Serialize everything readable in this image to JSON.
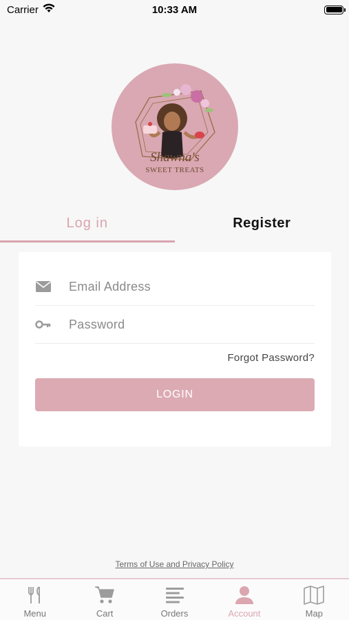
{
  "status_bar": {
    "carrier": "Carrier",
    "time": "10:33 AM"
  },
  "logo": {
    "line1": "Shawna's",
    "line2": "SWEET TREATS"
  },
  "tabs": {
    "login": "Log in",
    "register": "Register",
    "active": "login"
  },
  "form": {
    "email_placeholder": "Email Address",
    "password_placeholder": "Password",
    "forgot_label": "Forgot Password?",
    "login_label": "LOGIN"
  },
  "terms_label": "Terms of Use and Privacy Policy",
  "nav": {
    "items": [
      {
        "label": "Menu",
        "icon": "fork-knife-icon"
      },
      {
        "label": "Cart",
        "icon": "cart-icon"
      },
      {
        "label": "Orders",
        "icon": "list-icon"
      },
      {
        "label": "Account",
        "icon": "person-icon"
      },
      {
        "label": "Map",
        "icon": "map-icon"
      }
    ],
    "active": "Account"
  },
  "colors": {
    "accent": "#d8a4ae",
    "background": "#f7f7f7",
    "logo_bg": "#d9a8b3"
  }
}
